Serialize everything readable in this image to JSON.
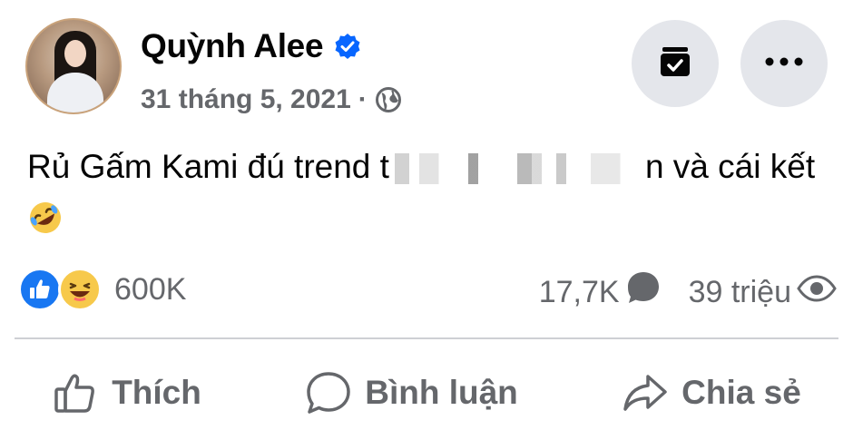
{
  "post": {
    "author": "Quỳnh Alee",
    "date": "31 tháng 5, 2021",
    "separator": "·",
    "text_before": "Rủ Gấm Kami đú trend t",
    "text_after": "n và cái kết",
    "emoji": "rolling-on-floor-laughing"
  },
  "stats": {
    "reactions_count": "600K",
    "comments_count": "17,7K",
    "views_count": "39 triệu"
  },
  "actions": {
    "like": "Thích",
    "comment": "Bình luận",
    "share": "Chia sẻ"
  },
  "icons": {
    "verified": "verified-badge-icon",
    "privacy": "globe-icon",
    "archive": "archive-icon",
    "more": "more-icon",
    "comment": "comment-bubble-icon",
    "views": "eye-icon"
  },
  "colors": {
    "verified_blue": "#0866ff",
    "secondary_text": "#65676b",
    "button_bg": "#e4e6eb",
    "like_blue": "#1877f2",
    "haha_yellow": "#f7c94b"
  }
}
